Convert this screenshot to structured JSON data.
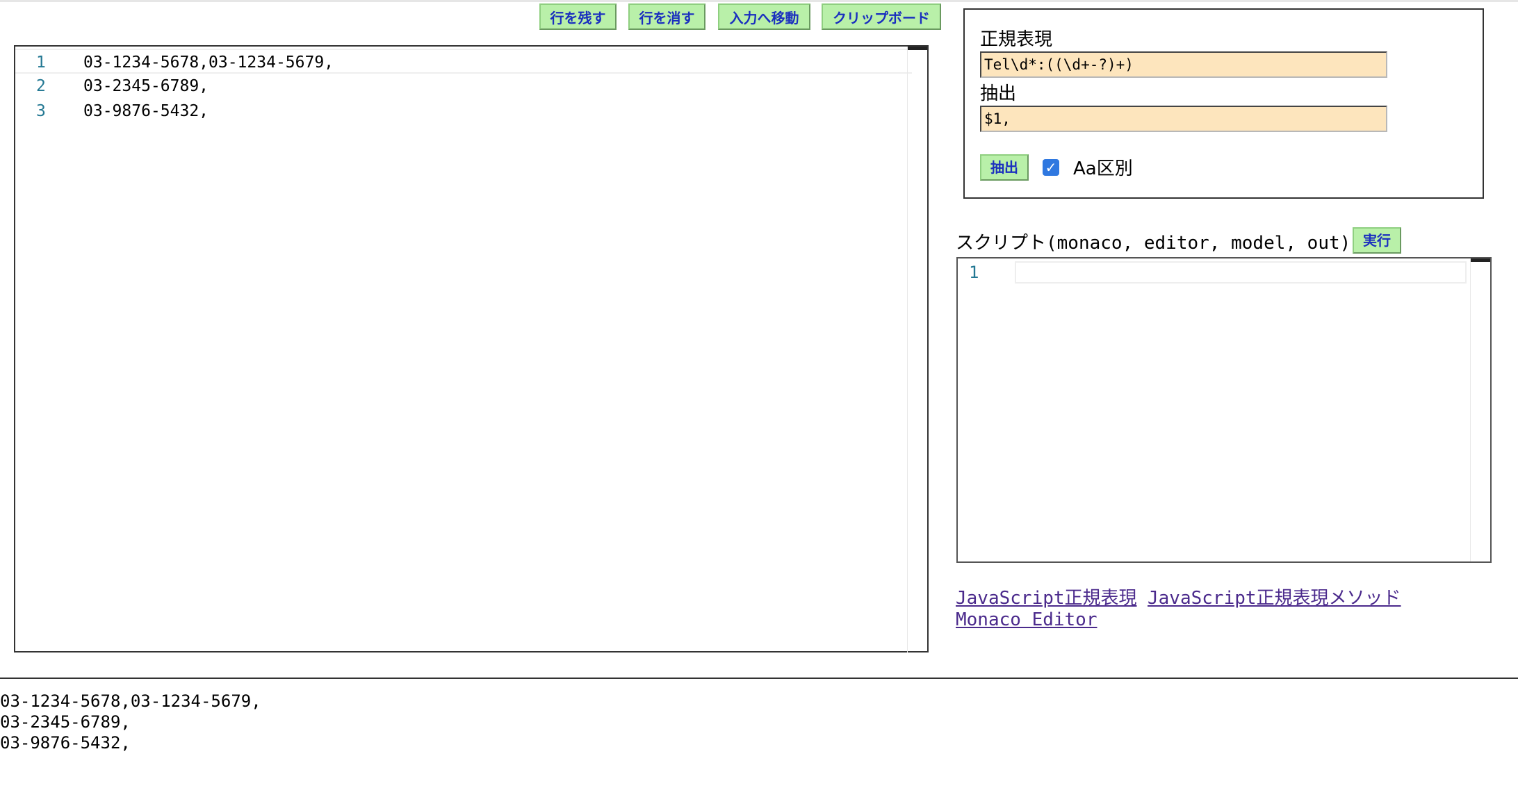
{
  "toolbar": {
    "keep_lines": "行を残す",
    "delete_lines": "行を消す",
    "move_to_input": "入力へ移動",
    "clipboard": "クリップボード"
  },
  "editor": {
    "lines": [
      {
        "num": "1",
        "text": "03-1234-5678,03-1234-5679,"
      },
      {
        "num": "2",
        "text": "03-2345-6789,"
      },
      {
        "num": "3",
        "text": "03-9876-5432,"
      }
    ]
  },
  "regex_panel": {
    "regex_label": "正規表現",
    "regex_value": "Tel\\d*:((\\d+-?)+)",
    "extract_label": "抽出",
    "extract_value": "$1,",
    "extract_button": "抽出",
    "case_checkbox_label": "Aa区別",
    "case_checked": true
  },
  "script": {
    "label": "スクリプト(monaco, editor, model, out)",
    "run_button": "実行",
    "line_number": "1"
  },
  "links": {
    "js_regex": "JavaScript正規表現",
    "js_regex_methods": "JavaScript正規表現メソッド",
    "monaco_editor": "Monaco Editor"
  },
  "output": {
    "lines": [
      "03-1234-5678,03-1234-5679,",
      "03-2345-6789,",
      "03-9876-5432,"
    ]
  }
}
